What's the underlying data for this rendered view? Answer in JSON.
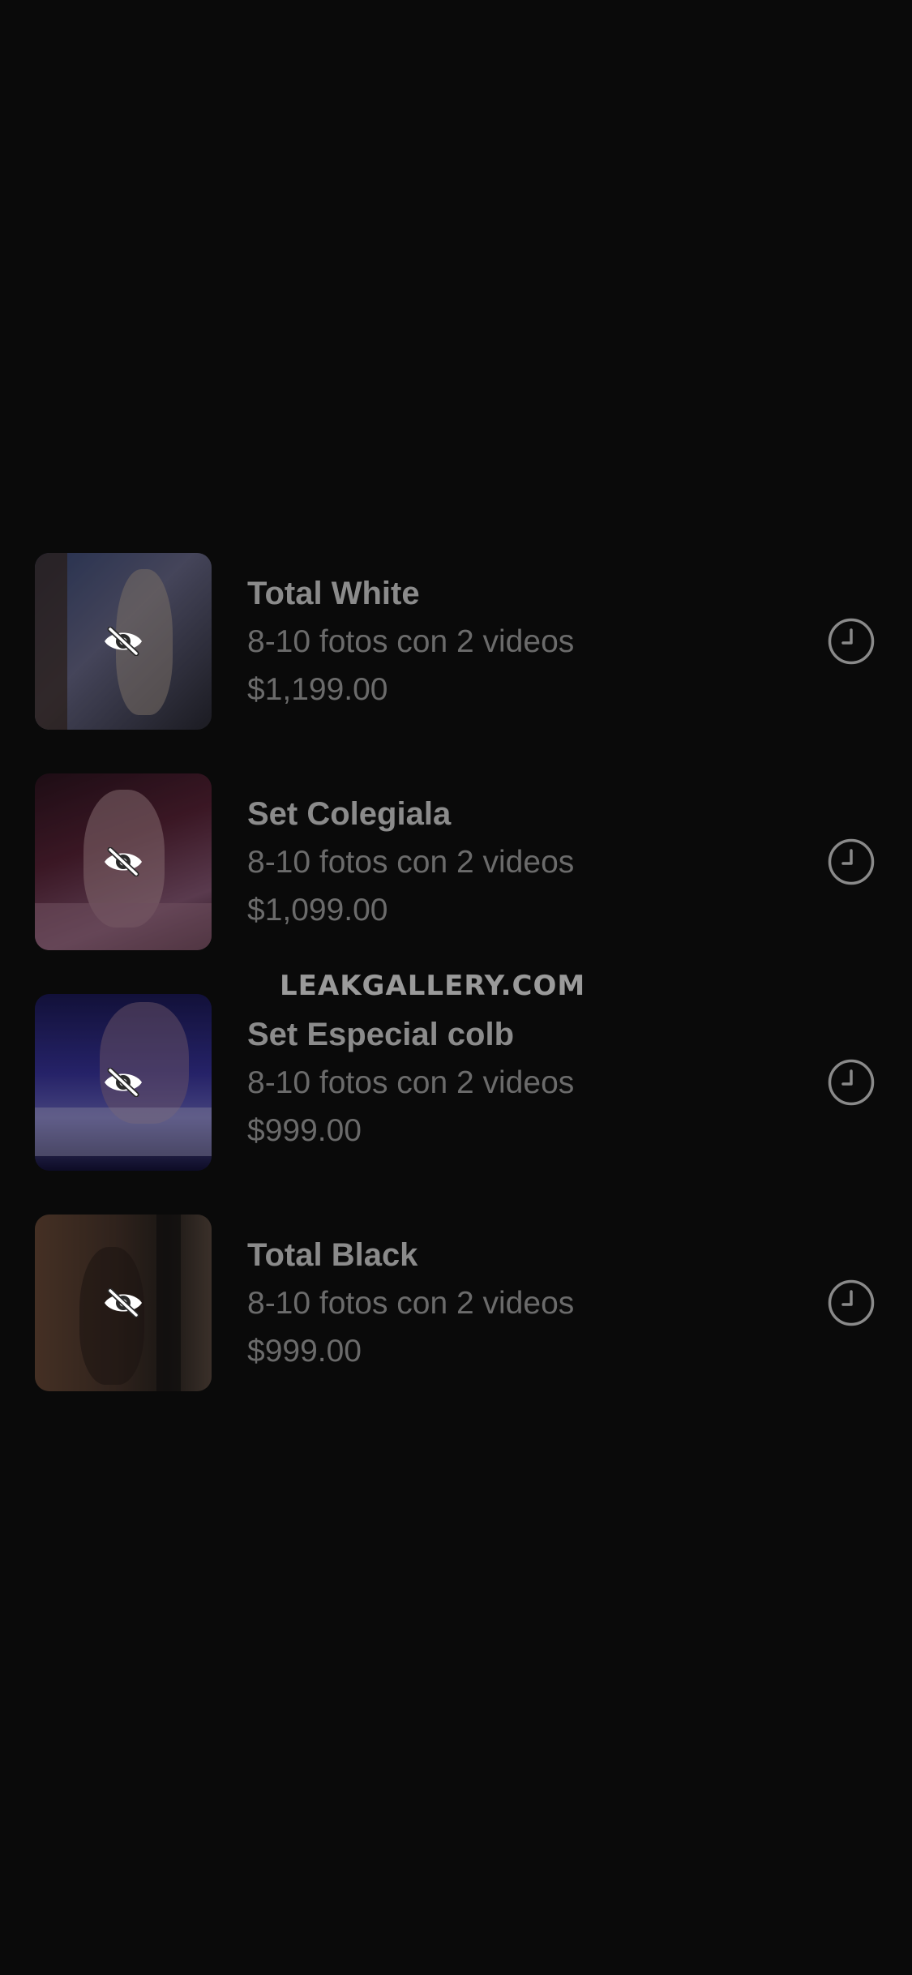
{
  "items": [
    {
      "title": "Total White",
      "subtitle": "8-10 fotos con 2 videos",
      "price": "$1,199.00",
      "hidden_icon": "eye-slash-icon",
      "status_icon": "clock-icon",
      "thumb_colors": [
        "#4b4e6a",
        "#6f6a8a",
        "#2a2c3c"
      ]
    },
    {
      "title": "Set Colegiala",
      "subtitle": "8-10 fotos con 2 videos",
      "price": "$1,099.00",
      "hidden_icon": "eye-slash-icon",
      "status_icon": "clock-icon",
      "thumb_colors": [
        "#3d1a28",
        "#8b4a6a",
        "#5a2a3c"
      ]
    },
    {
      "title": "Set Especial colb",
      "subtitle": "8-10 fotos con 2 videos",
      "price": "$999.00",
      "hidden_icon": "eye-slash-icon",
      "status_icon": "clock-icon",
      "thumb_colors": [
        "#2a2470",
        "#5a4fb8",
        "#1a1646"
      ]
    },
    {
      "title": "Total Black",
      "subtitle": "8-10 fotos con 2 videos",
      "price": "$999.00",
      "hidden_icon": "eye-slash-icon",
      "status_icon": "clock-icon",
      "thumb_colors": [
        "#5a4030",
        "#3a2e28",
        "#7a5a44"
      ]
    }
  ],
  "watermark": "LEAKGALLERY.COM"
}
